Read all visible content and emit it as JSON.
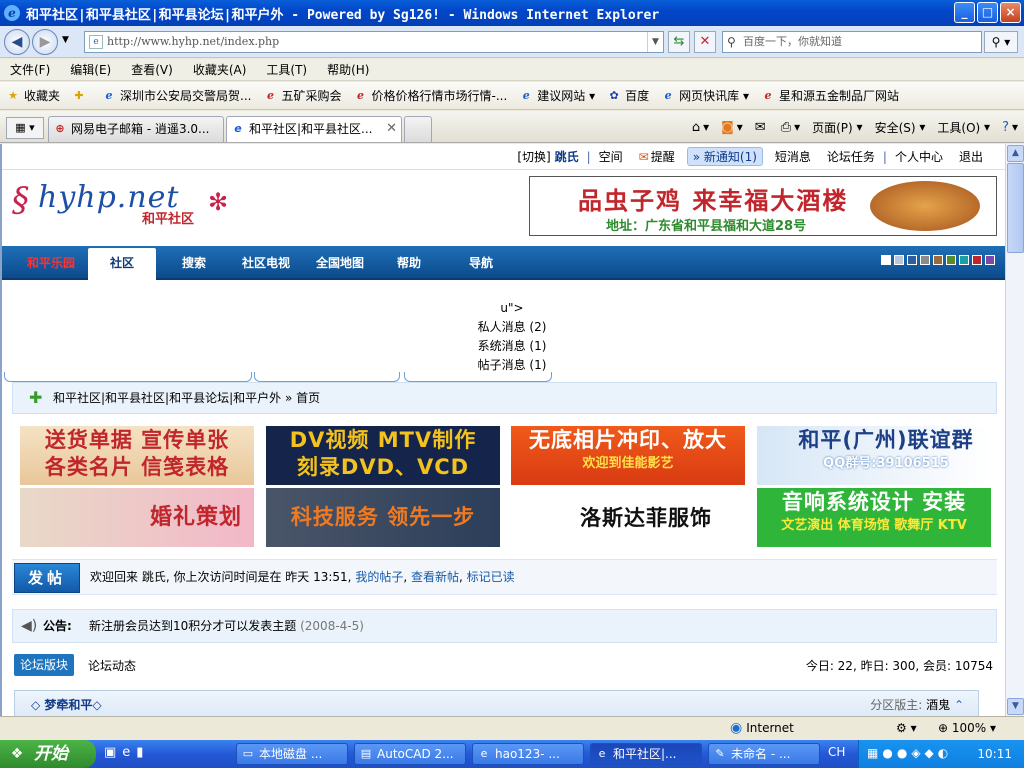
{
  "window": {
    "title": "和平社区|和平县社区|和平县论坛|和平户外 - Powered by Sg126! - Windows Internet Explorer",
    "controls": [
      "_",
      "□",
      "×"
    ]
  },
  "address": {
    "url": "http://www.hyhp.net/index.php",
    "search_placeholder": "百度一下，你就知道"
  },
  "menu": [
    "文件(F)",
    "编辑(E)",
    "查看(V)",
    "收藏夹(A)",
    "工具(T)",
    "帮助(H)"
  ],
  "favorites": {
    "label": "收藏夹",
    "items": [
      {
        "label": "深圳市公安局交警局贺...",
        "icon": "ie"
      },
      {
        "label": "五矿采购会",
        "icon": "red"
      },
      {
        "label": "价格价格行情市场行情-...",
        "icon": "red"
      },
      {
        "label": "建议网站 ▾",
        "icon": "ie"
      },
      {
        "label": "百度",
        "icon": "paw"
      },
      {
        "label": "网页快讯库 ▾",
        "icon": "ie"
      },
      {
        "label": "星和源五金制品厂网站",
        "icon": "red"
      }
    ]
  },
  "tabs": [
    {
      "label": "网易电子邮箱 - 逍遥3.0...",
      "active": false
    },
    {
      "label": "和平社区|和平县社区...",
      "active": true
    }
  ],
  "commands": {
    "page": "页面(P)",
    "safety": "安全(S)",
    "tools": "工具(O)"
  },
  "page": {
    "topbar": {
      "switch": "[切换]",
      "username": "跳氏",
      "space": "空间",
      "remind": "提醒",
      "new_notice": "新通知(1)",
      "sms": "短消息",
      "tasks": "论坛任务",
      "personal": "个人中心",
      "logout": "退出"
    },
    "logo": {
      "wordmark": "hyhp.net",
      "subtitle": "和平社区"
    },
    "top_ad": {
      "line1": "品虫子鸡  来幸福大酒楼",
      "line2": "地址：广东省和平县福和大道28号"
    },
    "nav": [
      "和平乐园",
      "社区",
      "搜索",
      "社区电视",
      "全国地图",
      "帮助",
      "导航"
    ],
    "skin_colors": [
      "#ffffff",
      "#b9c7d8",
      "#2f5f9c",
      "#8b8b8b",
      "#9b6b3b",
      "#5a8c2f",
      "#1aa0a0",
      "#c0262b",
      "#7b4aa8"
    ],
    "message_dropdown": {
      "stray": "u\">",
      "private": "私人消息 (2)",
      "system": "系统消息 (1)",
      "post": "帖子消息 (1)"
    },
    "breadcrumb": {
      "site": "和平社区|和平县社区|和平县论坛|和平户外",
      "sep": "»",
      "current": "首页"
    },
    "ads": [
      {
        "t1": "送货单据  宣传单张",
        "t2": "各类名片  信笺表格"
      },
      {
        "t1": "DV视频  MTV制作",
        "t2": "刻录DVD、VCD"
      },
      {
        "t1": "无底相片冲印、放大",
        "sm": "欢迎到佳能影艺"
      },
      {
        "t1": "和平(广州)联谊群",
        "sm": "QQ群号:39106515"
      },
      {
        "t1": "婚礼策划"
      },
      {
        "t1": "科技服务 领先一步"
      },
      {
        "t1": "洛斯达菲服饰"
      },
      {
        "t1": "音响系统设计 安装",
        "sm": "文艺演出 体育场馆 歌舞厅 KTV"
      }
    ],
    "postbar": {
      "button": "发帖",
      "welcome": "欢迎回来 跳氏, 你上次访问时间是在 昨天 13:51,",
      "my_posts": "我的帖子",
      "new_posts": "查看新帖",
      "mark_read": "标记已读"
    },
    "announcement": {
      "label": "公告:",
      "text": "新注册会员达到10积分才可以发表主题",
      "date": "(2008-4-5)"
    },
    "forum_tabs": {
      "sections": "论坛版块",
      "activity": "论坛动态",
      "stats": "今日: 22, 昨日: 300, 会员: 10754"
    },
    "section": {
      "name": "◇ 梦牵和平◇",
      "moderator_label": "分区版主:",
      "moderator": "酒鬼"
    }
  },
  "status": {
    "zone": "Internet",
    "zoom": "100%"
  },
  "taskbar": {
    "start": "开始",
    "tasks": [
      {
        "label": "本地磁盘 ...",
        "active": false
      },
      {
        "label": "AutoCAD 2...",
        "active": false
      },
      {
        "label": "hao123- ...",
        "active": false
      },
      {
        "label": "和平社区|...",
        "active": true
      },
      {
        "label": "未命名 - ...",
        "active": false
      }
    ],
    "lang": "CH",
    "clock": "10:11"
  }
}
